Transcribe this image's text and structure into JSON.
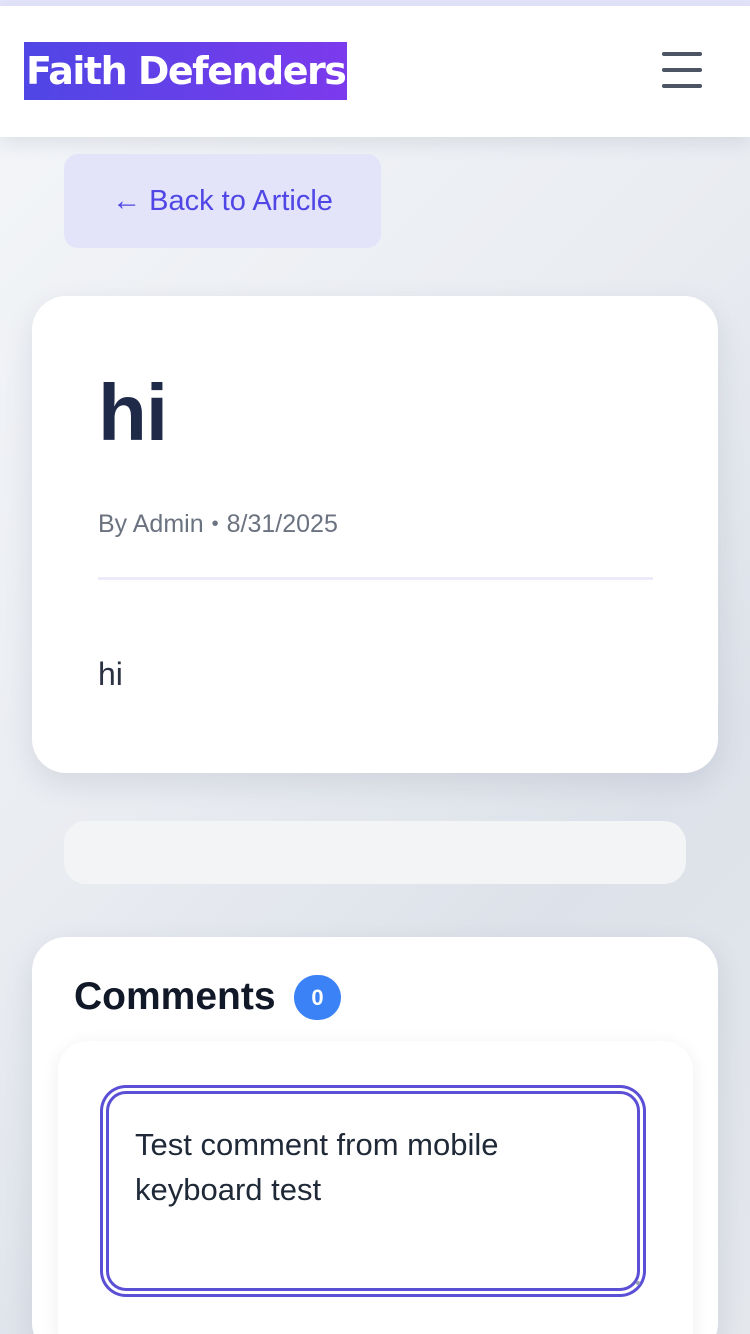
{
  "header": {
    "brand": "Faith Defenders",
    "menu_icon": "hamburger-menu-icon"
  },
  "nav": {
    "back_label": "← Back to Article"
  },
  "article": {
    "title": "hi",
    "author": "By Admin",
    "separator": "•",
    "date": "8/31/2025",
    "body": "hi"
  },
  "comments": {
    "title": "Comments",
    "count": "0",
    "input_value": "Test comment from mobile keyboard test"
  },
  "colors": {
    "accent": "#4f46e5",
    "brand_gradient_end": "#7c3aed",
    "badge": "#3b82f6",
    "title_text": "#1e2a47"
  }
}
